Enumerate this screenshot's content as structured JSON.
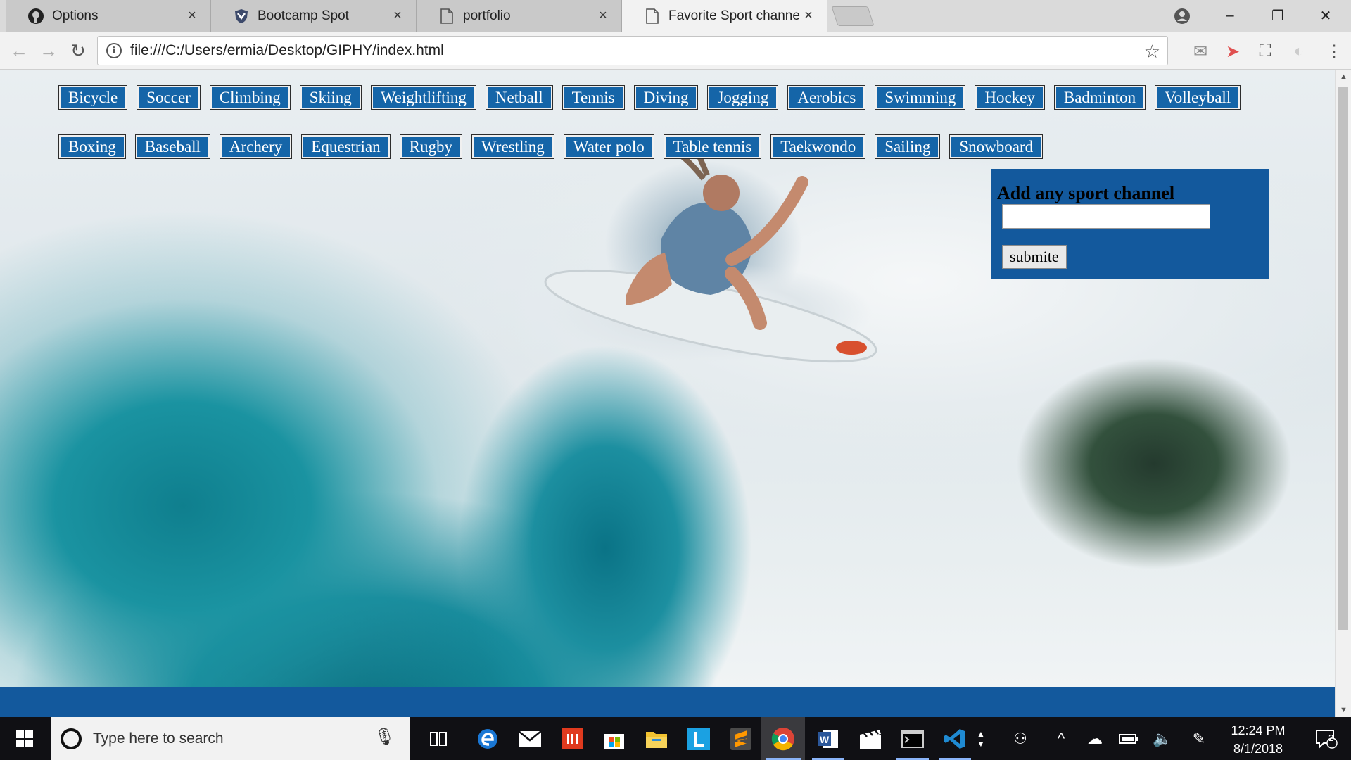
{
  "browser": {
    "tabs": [
      {
        "label": "Options",
        "icon": "github-icon"
      },
      {
        "label": "Bootcamp Spot",
        "icon": "shield-icon"
      },
      {
        "label": "portfolio",
        "icon": "page-icon"
      },
      {
        "label": "Favorite Sport channels",
        "icon": "page-icon",
        "active": true
      }
    ],
    "close_glyph": "×",
    "address_url": "file:///C:/Users/ermia/Desktop/GIPHY/index.html",
    "window_controls": {
      "minimize": "–",
      "restore": "❐",
      "close": "✕"
    }
  },
  "page": {
    "sports_row1": [
      "Bicycle",
      "Soccer",
      "Climbing",
      "Skiing",
      "Weightlifting",
      "Netball",
      "Tennis",
      "Diving",
      "Jogging",
      "Aerobics",
      "Swimming",
      "Hockey",
      "Badminton",
      "Volleyball"
    ],
    "sports_row2": [
      "Boxing",
      "Baseball",
      "Archery",
      "Equestrian",
      "Rugby",
      "Wrestling",
      "Water polo",
      "Table tennis",
      "Taekwondo",
      "Sailing",
      "Snowboard"
    ],
    "add_panel": {
      "heading": "Add any sport channel",
      "input_value": "",
      "submit_label": "submite"
    },
    "colors": {
      "button_bg": "#1565a8",
      "panel_bg": "#13599d"
    }
  },
  "taskbar": {
    "search_placeholder": "Type here to search",
    "apps": [
      "task-view-icon",
      "edge-icon",
      "mail-icon",
      "office-red-icon",
      "store-icon",
      "file-explorer-icon",
      "l-app-icon",
      "sublime-icon",
      "chrome-icon",
      "word-icon",
      "movies-icon",
      "terminal-icon",
      "vscode-icon"
    ],
    "time": "12:24 PM",
    "date": "8/1/2018",
    "notification_count": "2"
  }
}
